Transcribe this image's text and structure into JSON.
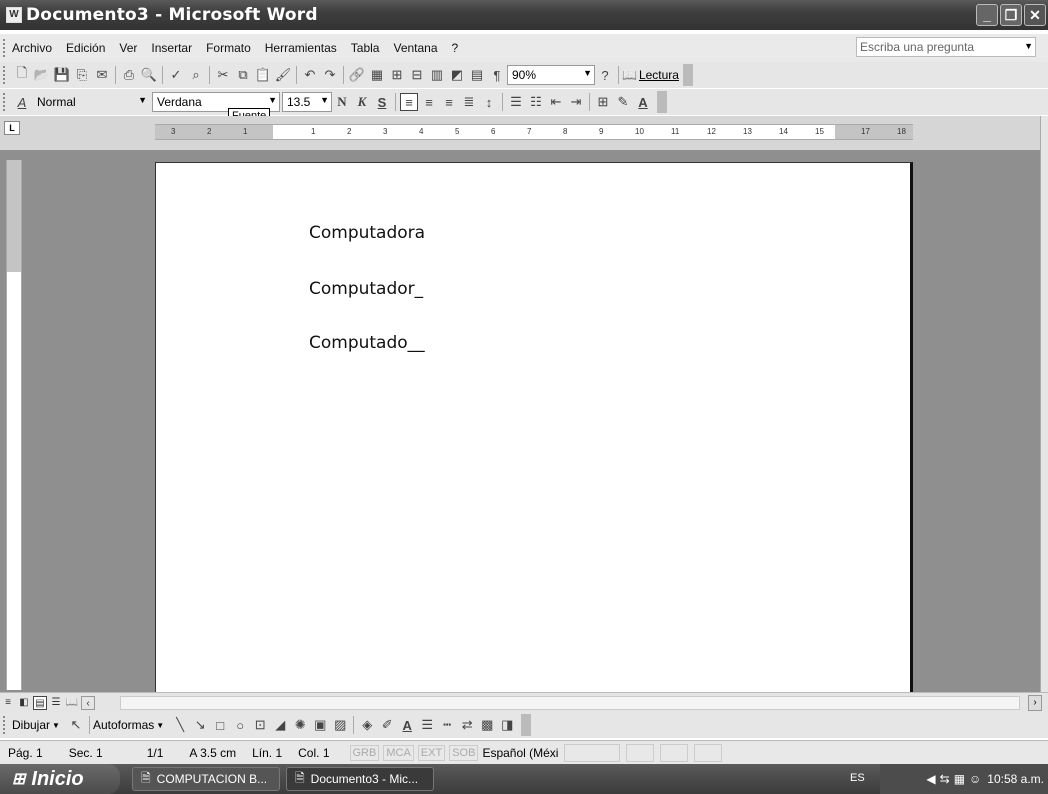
{
  "window": {
    "title": "Documento3 - Microsoft Word"
  },
  "menu": {
    "items": [
      "Archivo",
      "Edición",
      "Ver",
      "Insertar",
      "Formato",
      "Herramientas",
      "Tabla",
      "Ventana",
      "?"
    ],
    "help_placeholder": "Escriba una pregunta"
  },
  "standard_toolbar": {
    "zoom": "90%",
    "reading_label": "Lectura"
  },
  "format_toolbar": {
    "style": "Normal",
    "font": "Verdana",
    "size": "13.5",
    "bold": "N",
    "italic": "K",
    "underline": "S"
  },
  "tooltip": "Fuente",
  "ruler": {
    "numbers": [
      "3",
      "2",
      "1",
      "1",
      "2",
      "3",
      "4",
      "5",
      "6",
      "7",
      "8",
      "9",
      "10",
      "11",
      "12",
      "13",
      "14",
      "15",
      "17",
      "18"
    ]
  },
  "document": {
    "lines": [
      "Computadora",
      "Computador_",
      "Computado__"
    ]
  },
  "drawing_toolbar": {
    "draw_label": "Dibujar",
    "autoshapes_label": "Autoformas"
  },
  "status": {
    "page": "Pág. 1",
    "section": "Sec. 1",
    "pages": "1/1",
    "at": "A 3.5 cm",
    "line": "Lín. 1",
    "col": "Col. 1",
    "grb": "GRB",
    "mca": "MCA",
    "ext": "EXT",
    "sob": "SOB",
    "language": "Español (Méxi"
  },
  "taskbar": {
    "start": "Inicio",
    "tasks": [
      "COMPUTACION B...",
      "Documento3 - Mic..."
    ],
    "lang": "ES",
    "clock": "10:58 a.m."
  }
}
